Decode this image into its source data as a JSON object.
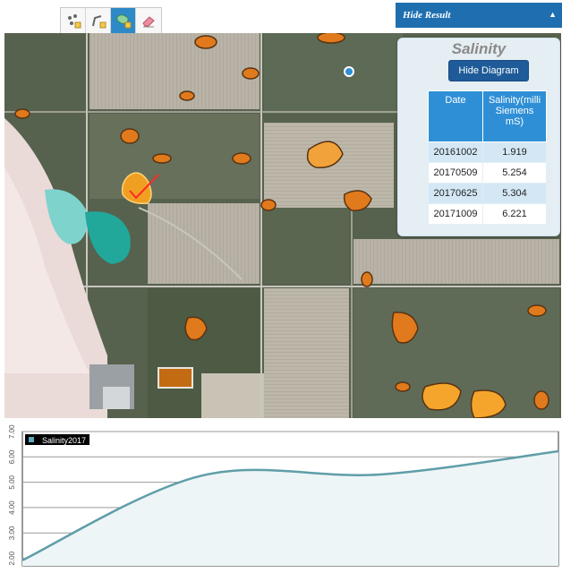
{
  "toolbar": {
    "tools": [
      {
        "name": "point-tool",
        "icon": "point-marker-icon"
      },
      {
        "name": "draw-line-tool",
        "icon": "polyline-icon"
      },
      {
        "name": "draw-polygon-tool",
        "icon": "polygon-icon",
        "active": true
      },
      {
        "name": "erase-tool",
        "icon": "eraser-icon"
      }
    ]
  },
  "result_bar": {
    "label": "Hide Result"
  },
  "panel": {
    "title": "Salinity",
    "hide_diagram_label": "Hide Diagram",
    "table": {
      "headers": [
        "Date",
        "Salinity(milli Siemens mS)"
      ],
      "rows": [
        {
          "date": "20161002",
          "value": "1.919"
        },
        {
          "date": "20170509",
          "value": "5.254"
        },
        {
          "date": "20170625",
          "value": "5.304"
        },
        {
          "date": "20171009",
          "value": "6.221"
        }
      ]
    }
  },
  "colors": {
    "accent": "#2f8fd6",
    "toolbar_active": "#2d89c8",
    "result_bar": "#1f6fb0",
    "line": "#5f9ea8",
    "polygon": "#f0a020",
    "marker": "#ff2a2a"
  },
  "chart_data": {
    "type": "line",
    "series": [
      {
        "name": "Salinity2017",
        "x": [
          "20161002",
          "20170509",
          "20170625",
          "20171009"
        ],
        "values": [
          1.919,
          5.254,
          5.304,
          6.221
        ]
      }
    ],
    "y_ticks": [
      "2.00",
      "3.00",
      "4.00",
      "5.00",
      "6.00",
      "7.00"
    ],
    "ylim": [
      1.7,
      7.0
    ],
    "grid": true,
    "legend_position": "top-left"
  }
}
